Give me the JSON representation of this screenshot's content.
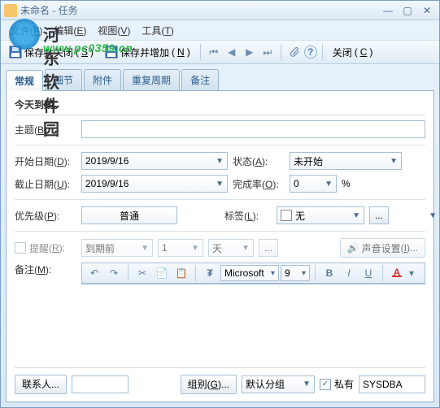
{
  "window": {
    "title": "未命名 - 任务"
  },
  "watermark": {
    "text": "河东软件园",
    "url": "www.pc0359.cn"
  },
  "menu": {
    "file": {
      "label": "文件",
      "hotkey": "F"
    },
    "edit": {
      "label": "编辑",
      "hotkey": "E"
    },
    "view": {
      "label": "视图",
      "hotkey": "V"
    },
    "tools": {
      "label": "工具",
      "hotkey": "T"
    }
  },
  "toolbar": {
    "save_close": {
      "label": "保存并关闭",
      "hotkey": "S"
    },
    "save_add": {
      "label": "保存并增加",
      "hotkey": "N"
    },
    "close": {
      "label": "关闭",
      "hotkey": "C"
    }
  },
  "tabs": {
    "general": "常规",
    "details": "细节",
    "attachments": "附件",
    "recurrence": "重复周期",
    "notes": "备注"
  },
  "panel": {
    "due_banner": "今天到期。",
    "subject_label": "主题",
    "subject_hotkey": "B",
    "subject_value": "",
    "start_label": "开始日期",
    "start_hotkey": "D",
    "start_value": "2019/9/16",
    "status_label": "状态",
    "status_hotkey": "A",
    "status_value": "未开始",
    "end_label": "截止日期",
    "end_hotkey": "U",
    "end_value": "2019/9/16",
    "complete_label": "完成率",
    "complete_hotkey": "O",
    "complete_value": "0",
    "complete_unit": "%",
    "priority_label": "优先级",
    "priority_hotkey": "P",
    "priority_value": "普通",
    "tag_label": "标签",
    "tag_hotkey": "L",
    "tag_value": "无",
    "reminder_label": "提醒",
    "reminder_hotkey": "R",
    "reminder_when": "到期前",
    "reminder_num": "1",
    "reminder_unit": "天",
    "sound_label": "声音设置",
    "sound_hotkey": "I",
    "memo_label": "备注",
    "memo_hotkey": "M"
  },
  "editor": {
    "font": "Microsoft",
    "size": "9"
  },
  "footer": {
    "contacts": "联系人...",
    "group_label": "组别",
    "group_hotkey": "G",
    "group_value": "默认分组",
    "private_label": "私有",
    "owner": "SYSDBA"
  }
}
